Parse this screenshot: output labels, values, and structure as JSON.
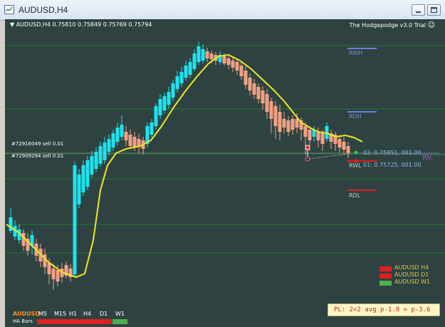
{
  "window": {
    "title": "AUDUSD,H4"
  },
  "chart": {
    "header": {
      "symbol_tf": "AUDUSD,H4",
      "ohlc": "0.75810 0.75849 0.75769 0.75794",
      "indicator_title": "The Hodgepodge v3.0 Trial"
    },
    "levels": {
      "rwh": "RWH",
      "rdh": "RDH",
      "rwl": "RWL",
      "rdl": "RDL",
      "rv": "RV:"
    },
    "orders": [
      {
        "label": "#72916049 sell 0.01"
      },
      {
        "label": "#72909294 sell 0.01"
      }
    ],
    "targets": [
      {
        "label": "02: 0.75851,   001.00"
      },
      {
        "label": "01: 0.75725,   001.00"
      }
    ],
    "legend": [
      {
        "label": "AUDUSD H4",
        "color": "#e02020"
      },
      {
        "label": "AUDUSD D1",
        "color": "#e02020"
      },
      {
        "label": "AUDUSD W1",
        "color": "#4caf50"
      }
    ],
    "pl_text": "PL: 2<2 avg p-1.8 = p-3.6",
    "mtf": {
      "symbol": "AUDUSD",
      "timeframes": [
        "M5",
        "M15",
        "H1",
        "H4",
        "D1",
        "W1"
      ],
      "row_label": "HA Bars",
      "colors": [
        "#e02020",
        "#e02020",
        "#e02020",
        "#e02020",
        "#e02020",
        "#4caf50"
      ]
    },
    "colors": {
      "background": "#2e4341",
      "bull": "#1de3ee",
      "bear": "#f2a083",
      "ma": "#f0e62a",
      "grid": "#1e7a30"
    }
  }
}
